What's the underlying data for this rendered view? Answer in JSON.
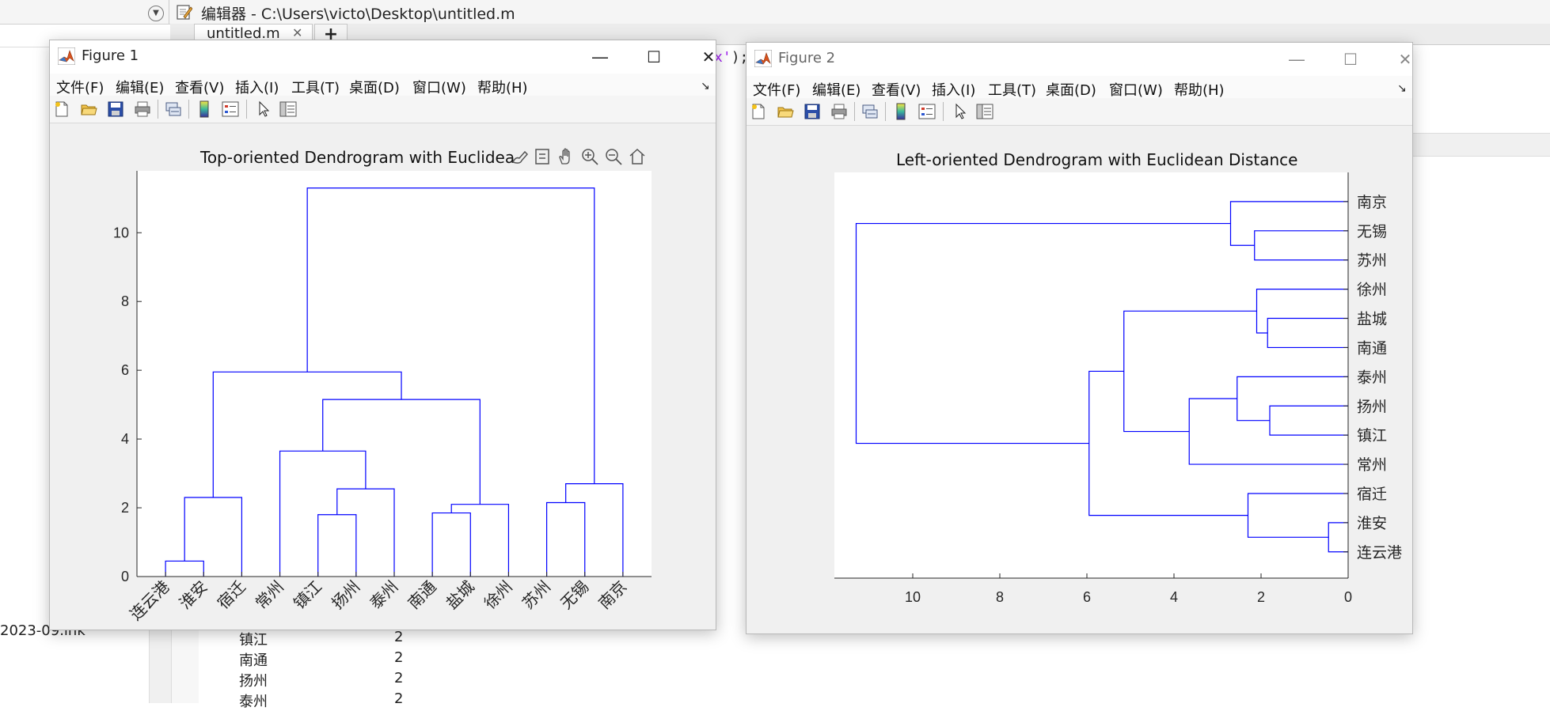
{
  "editor": {
    "title": "编辑器 - C:\\Users\\victo\\Desktop\\untitled.m",
    "tab_label": "untitled.m",
    "tab_close": "✕",
    "new_tab": "+",
    "code_fragment_string": "x'",
    "code_fragment_rest": ");"
  },
  "workspace": {
    "file_name": "2023-09.lnk",
    "rows": [
      {
        "name": "镇江",
        "value": "2"
      },
      {
        "name": "南通",
        "value": "2"
      },
      {
        "name": "扬州",
        "value": "2"
      },
      {
        "name": "泰州",
        "value": "2"
      }
    ]
  },
  "figure1": {
    "title": "Figure 1",
    "menu": [
      "文件(F)",
      "编辑(E)",
      "查看(V)",
      "插入(I)",
      "工具(T)",
      "桌面(D)",
      "窗口(W)",
      "帮助(H)"
    ],
    "axes_title": "Top-oriented Dendrogram with Euclidea",
    "toolbar_icons": [
      "new-file-icon",
      "open-folder-icon",
      "save-icon",
      "print-icon",
      "link-plot-icon",
      "colorbar-icon",
      "legend-icon",
      "pointer-icon",
      "property-inspector-icon"
    ],
    "axes_toolbar_icons": [
      "brush-icon",
      "data-tip-icon",
      "pan-icon",
      "zoom-in-icon",
      "zoom-out-icon",
      "home-icon"
    ]
  },
  "figure2": {
    "title": "Figure 2",
    "menu": [
      "文件(F)",
      "编辑(E)",
      "查看(V)",
      "插入(I)",
      "工具(T)",
      "桌面(D)",
      "窗口(W)",
      "帮助(H)"
    ],
    "axes_title": "Left-oriented Dendrogram with Euclidean Distance",
    "toolbar_icons": [
      "new-file-icon",
      "open-folder-icon",
      "save-icon",
      "print-icon",
      "link-plot-icon",
      "colorbar-icon",
      "legend-icon",
      "pointer-icon",
      "property-inspector-icon"
    ]
  },
  "colors": {
    "dendrogram": "#0000ff",
    "axes": "#262626",
    "figure_bg": "#f0f0f0"
  },
  "chart_data": [
    {
      "type": "dendrogram",
      "orientation": "top",
      "title": "Top-oriented Dendrogram with Euclidea",
      "leaves": [
        "连云港",
        "淮安",
        "宿迁",
        "常州",
        "镇江",
        "扬州",
        "泰州",
        "南通",
        "盐城",
        "徐州",
        "苏州",
        "无锡",
        "南京"
      ],
      "ylim": [
        0,
        11.8
      ],
      "yticks": [
        0,
        2,
        4,
        6,
        8,
        10
      ],
      "links": [
        {
          "a": 0,
          "b": 1,
          "h": 0.45
        },
        {
          "a": 13,
          "b": 2,
          "h": 2.3
        },
        {
          "a": 4,
          "b": 5,
          "h": 1.8
        },
        {
          "a": 15,
          "b": 6,
          "h": 2.55
        },
        {
          "a": 3,
          "b": 16,
          "h": 3.65
        },
        {
          "a": 7,
          "b": 8,
          "h": 1.85
        },
        {
          "a": 18,
          "b": 9,
          "h": 2.1
        },
        {
          "a": 17,
          "b": 19,
          "h": 5.15
        },
        {
          "a": 14,
          "b": 20,
          "h": 5.95
        },
        {
          "a": 10,
          "b": 11,
          "h": 2.15
        },
        {
          "a": 22,
          "b": 12,
          "h": 2.7
        },
        {
          "a": 21,
          "b": 23,
          "h": 11.3
        }
      ]
    },
    {
      "type": "dendrogram",
      "orientation": "left",
      "title": "Left-oriented Dendrogram with Euclidean Distance",
      "leaves": [
        "南京",
        "无锡",
        "苏州",
        "徐州",
        "盐城",
        "南通",
        "泰州",
        "扬州",
        "镇江",
        "常州",
        "宿迁",
        "淮安",
        "连云港"
      ],
      "xlim": [
        0,
        11.8
      ],
      "xticks": [
        10,
        8,
        6,
        4,
        2,
        0
      ],
      "links": [
        {
          "a": 1,
          "b": 2,
          "h": 2.15
        },
        {
          "a": 0,
          "b": 13,
          "h": 2.7
        },
        {
          "a": 4,
          "b": 5,
          "h": 1.85
        },
        {
          "a": 3,
          "b": 15,
          "h": 2.1
        },
        {
          "a": 7,
          "b": 8,
          "h": 1.8
        },
        {
          "a": 6,
          "b": 17,
          "h": 2.55
        },
        {
          "a": 18,
          "b": 9,
          "h": 3.65
        },
        {
          "a": 16,
          "b": 19,
          "h": 5.15
        },
        {
          "a": 11,
          "b": 12,
          "h": 0.45
        },
        {
          "a": 10,
          "b": 21,
          "h": 2.3
        },
        {
          "a": 20,
          "b": 22,
          "h": 5.95
        },
        {
          "a": 14,
          "b": 23,
          "h": 11.3
        }
      ]
    }
  ]
}
